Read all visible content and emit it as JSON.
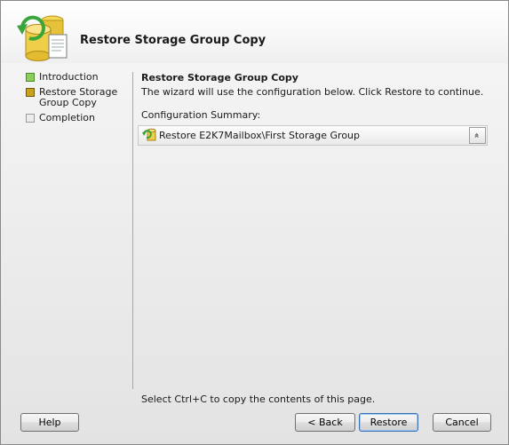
{
  "header": {
    "title": "Restore Storage Group Copy",
    "icon": "database-restore-icon"
  },
  "nav": {
    "items": [
      {
        "label": "Introduction",
        "state": "done",
        "color": "#8ad05a"
      },
      {
        "label": "Restore Storage Group Copy",
        "state": "current",
        "color": "#c8a21a"
      },
      {
        "label": "Completion",
        "state": "pending",
        "color": "#ececec"
      }
    ]
  },
  "content": {
    "title": "Restore Storage Group Copy",
    "description": "The wizard will use the configuration below.  Click Restore to continue.",
    "summary_label": "Configuration Summary:",
    "summary_item": "Restore E2K7Mailbox\\First Storage Group",
    "collapse_glyph": "»",
    "copy_hint": "Select Ctrl+C to copy the contents of this page."
  },
  "buttons": {
    "help": "Help",
    "back": "< Back",
    "restore": "Restore",
    "cancel": "Cancel"
  },
  "colors": {
    "default_button_border": "#3b6fb4"
  }
}
